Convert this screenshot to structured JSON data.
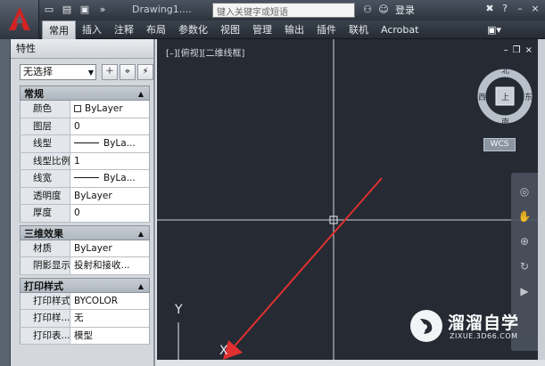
{
  "titlebar": {
    "doc_title": "Drawing1....",
    "search_placeholder": "键入关键字或短语",
    "login": "登录"
  },
  "ribbon": {
    "tabs": [
      "常用",
      "插入",
      "注释",
      "布局",
      "参数化",
      "视图",
      "管理",
      "输出",
      "插件",
      "联机",
      "Acrobat"
    ],
    "active_tab": "常用"
  },
  "panel": {
    "title": "特性",
    "selection": "无选择",
    "sections": [
      {
        "name": "常规",
        "props": [
          {
            "name": "颜色",
            "value": "ByLayer",
            "kind": "swatch"
          },
          {
            "name": "图层",
            "value": "0"
          },
          {
            "name": "线型",
            "value": "ByLa...",
            "kind": "line"
          },
          {
            "name": "线型比例",
            "value": "1"
          },
          {
            "name": "线宽",
            "value": "ByLa...",
            "kind": "line"
          },
          {
            "name": "透明度",
            "value": "ByLayer"
          },
          {
            "name": "厚度",
            "value": "0"
          }
        ]
      },
      {
        "name": "三维效果",
        "props": [
          {
            "name": "材质",
            "value": "ByLayer"
          },
          {
            "name": "阴影显示",
            "value": "投射和接收..."
          }
        ]
      },
      {
        "name": "打印样式",
        "props": [
          {
            "name": "打印样式",
            "value": "BYCOLOR"
          },
          {
            "name": "打印样...",
            "value": "无"
          },
          {
            "name": "打印表...",
            "value": "模型"
          }
        ]
      }
    ]
  },
  "viewport": {
    "label": "[–][俯视][二维线框]",
    "compass": {
      "north": "北",
      "south": "南",
      "east": "东",
      "west": "西",
      "center": "上"
    },
    "wcs": "WCS",
    "axis_y": "Y",
    "axis_x": "X",
    "arrow_color": "#e03030"
  },
  "watermark": {
    "brand": "溜溜自学",
    "url": "ZIXUE.3D66.COM"
  }
}
